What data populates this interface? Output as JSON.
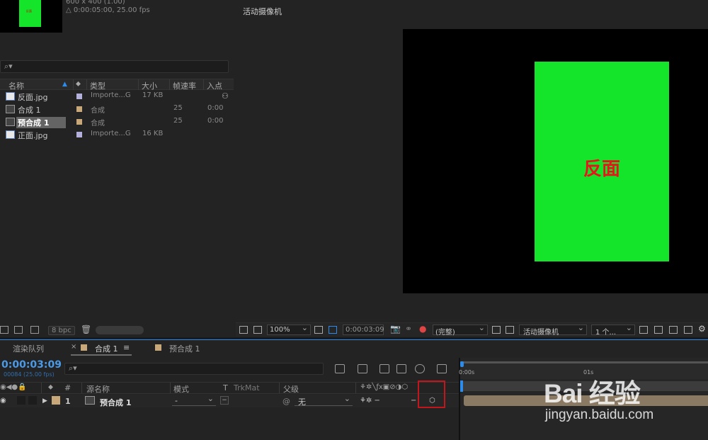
{
  "project": {
    "thumb_text": "反面",
    "info_line1": "600 x 400 (1.00)",
    "info_line2": "△ 0:00:05:00, 25.00 fps",
    "search_icon": "⌕▾",
    "columns": [
      "名称",
      "类型",
      "大小",
      "帧速率",
      "入点"
    ],
    "items": [
      {
        "name": "反面.jpg",
        "kind": "image",
        "label_color": "#b4b0dc",
        "type": "Importe...G",
        "size": "17 KB",
        "fps": "",
        "in": "",
        "selected": false
      },
      {
        "name": "合成 1",
        "kind": "comp",
        "label_color": "#c8a878",
        "type": "合成",
        "size": "",
        "fps": "25",
        "in": "0:00",
        "selected": false
      },
      {
        "name": "预合成 1",
        "kind": "comp",
        "label_color": "#c8a878",
        "type": "合成",
        "size": "",
        "fps": "25",
        "in": "0:00",
        "selected": true
      },
      {
        "name": "正面.jpg",
        "kind": "image",
        "label_color": "#b4b0dc",
        "type": "Importe...G",
        "size": "16 KB",
        "fps": "",
        "in": "",
        "selected": false
      }
    ],
    "bpc": "8 bpc"
  },
  "viewer": {
    "title": "活动摄像机",
    "canvas_text": "反面",
    "zoom": "100%",
    "timecode": "0:00:03:09",
    "resolution": "(完整)",
    "camera": "活动摄像机",
    "views": "1 个..."
  },
  "timeline": {
    "tabs": {
      "render_queue": "渲染队列",
      "comp1": "合成 1",
      "precomp1": "预合成 1"
    },
    "timecode": "0:00:03:09",
    "fps_line": "00084 (25.00 fps)",
    "search_icon": "⌕▾",
    "columns": {
      "num": "#",
      "source_name": "源名称",
      "mode": "模式",
      "t": "T",
      "trkmat": "TrkMat",
      "parent": "父级"
    },
    "layer": {
      "num": "1",
      "name": "预合成 1",
      "mode": "-",
      "parent": "无"
    },
    "ruler": {
      "t0": "0:00s",
      "t1": "01s"
    }
  },
  "watermark": {
    "main": "Bai 经验",
    "url": "jingyan.baidu.com"
  }
}
